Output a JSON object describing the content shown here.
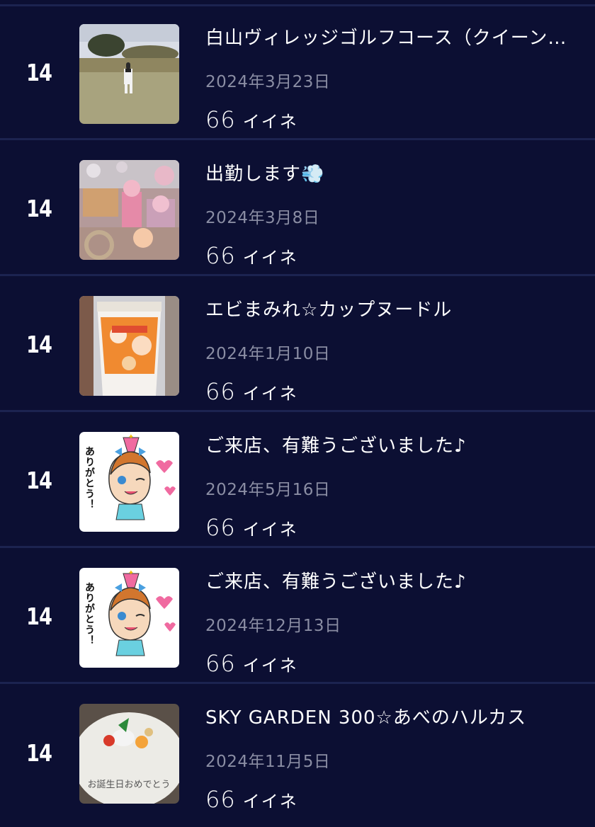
{
  "posts": [
    {
      "rank": "14",
      "title": "白山ヴィレッジゴルフコース（クイーン…",
      "date": "2024年3月23日",
      "likes_count": "66",
      "likes_label": "イイネ",
      "thumb": "golf-course-photo"
    },
    {
      "rank": "14",
      "title": "出勤します💨",
      "date": "2024年3月8日",
      "likes_count": "66",
      "likes_label": "イイネ",
      "thumb": "decorated-display-photo"
    },
    {
      "rank": "14",
      "title": "エビまみれ☆カップヌードル",
      "date": "2024年1月10日",
      "likes_count": "66",
      "likes_label": "イイネ",
      "thumb": "cup-noodle-photo"
    },
    {
      "rank": "14",
      "title": "ご来店、有難うございました♪",
      "date": "2024年5月16日",
      "likes_count": "66",
      "likes_label": "イイネ",
      "thumb": "thank-you-sticker",
      "thumb_text": "ありがとう！"
    },
    {
      "rank": "14",
      "title": "ご来店、有難うございました♪",
      "date": "2024年12月13日",
      "likes_count": "66",
      "likes_label": "イイネ",
      "thumb": "thank-you-sticker",
      "thumb_text": "ありがとう！"
    },
    {
      "rank": "14",
      "title": "SKY GARDEN 300☆あべのハルカス",
      "date": "2024年11月5日",
      "likes_count": "66",
      "likes_label": "イイネ",
      "thumb": "birthday-dessert-plate-photo",
      "thumb_text": "お誕生日おめでとう"
    }
  ],
  "colors": {
    "background": "#0c0f33",
    "divider": "#1c2350",
    "text_primary": "#ffffff",
    "text_secondary": "#8a8da3"
  }
}
